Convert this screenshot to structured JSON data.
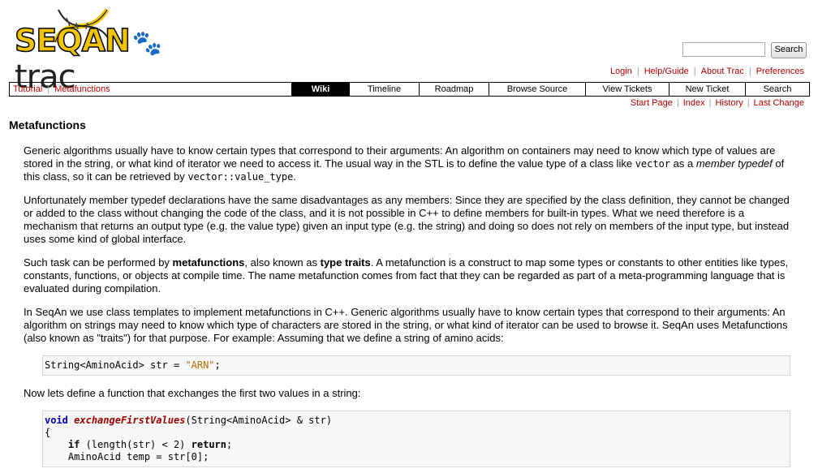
{
  "logo": {
    "part1": "SEQAN",
    "part2": "trac"
  },
  "search": {
    "button_label": "Search",
    "value": ""
  },
  "metanav": [
    "Login",
    "Help/Guide",
    "About Trac",
    "Preferences"
  ],
  "mainnav": {
    "left_links": [
      "Tutorial",
      "Metafunctions"
    ],
    "tabs": [
      "Wiki",
      "Timeline",
      "Roadmap",
      "Browse Source",
      "View Tickets",
      "New Ticket",
      "Search"
    ],
    "active": "Wiki"
  },
  "ctxnav": [
    "Start Page",
    "Index",
    "History",
    "Last Change"
  ],
  "page": {
    "title": "Metafunctions",
    "p1": {
      "a": "Generic algorithms usually have to know certain types that correspond to their arguments: An algorithm on containers may need to know which type of values are stored in the string, or what kind of iterator we need to access it. The usual way in the STL is to define the value type of a class like ",
      "code1": "vector",
      "b": " as a ",
      "em": "member typedef",
      "c": " of this class, so it can be retrieved by ",
      "code2": "vector::value_type",
      "d": "."
    },
    "p2": "Unfortunately member typedef declarations have the same disadvantages as any members: Since they are specified by the class definition, they cannot be changed or added to the class without changing the code of the class, and it is not possible in C++ to define members for built-in types. What we need therefore is a mechanism that returns an output type (e.g. the value type) given an input type (e.g. the string) and doing so does not rely on members of the input type, but instead uses some kind of global interface.",
    "p3": {
      "a": "Such task can be performed by ",
      "b1": "metafunctions",
      "b": ", also known as ",
      "b2": "type traits",
      "c": ". A metafunction is a construct to map some types or constants to other entities like types, constants, functions, or objects at compile time. The name metafunction comes from fact that they can be regarded as part of a meta-programming language that is evaluated during compilation."
    },
    "p4": "In SeqAn we use class templates to implement metafunctions in C++. Generic algorithms usually have to know certain types that correspond to their arguments: An algorithm on strings may need to know which type of characters are stored in the string, or what kind of iterator can be used to browse it. SeqAn uses Metafunctions (also known as \"traits\") for that purpose. For example: Assuming that we define a string of amino acids:",
    "code_block1": {
      "pre": "String<AminoAcid> str = ",
      "str": "\"ARN\"",
      "post": ";"
    },
    "p5": "Now lets define a function that exchanges the first two values in a string:",
    "code_block2": {
      "l1_kw": "void",
      "l1_fn": "exchangeFirstValues",
      "l1_rest": "(String<AminoAcid> & str)",
      "l2": "{",
      "l3_kw": "if",
      "l3_rest": " (length(str) < 2) ",
      "l3_kw2": "return",
      "l3_end": ";",
      "l4": "AminoAcid temp = str[0];"
    }
  }
}
